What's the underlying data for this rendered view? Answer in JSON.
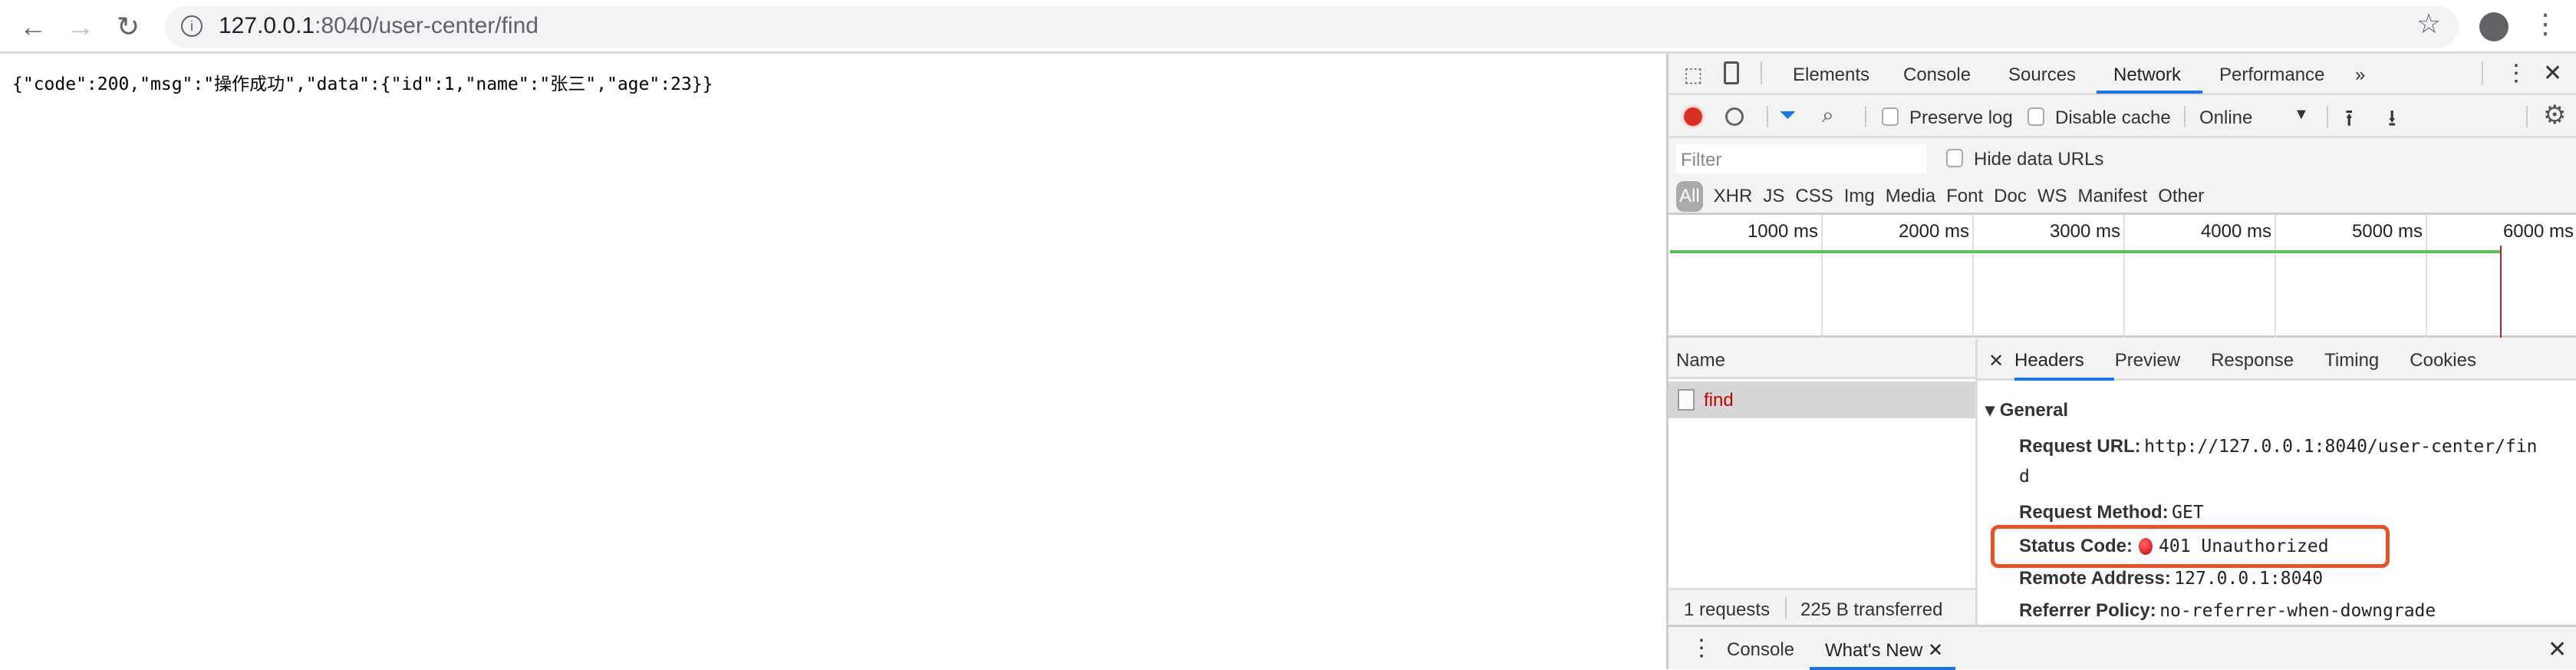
{
  "browser": {
    "url_host": "127.0.0.1",
    "url_rest": ":8040/user-center/find"
  },
  "page": {
    "body_text": "{\"code\":200,\"msg\":\"操作成功\",\"data\":{\"id\":1,\"name\":\"张三\",\"age\":23}}"
  },
  "devtools": {
    "tabs": [
      "Elements",
      "Console",
      "Sources",
      "Network",
      "Performance"
    ],
    "active_tab": "Network",
    "toolbar": {
      "preserve_log": "Preserve log",
      "disable_cache": "Disable cache",
      "throttle": "Online"
    },
    "filter": {
      "placeholder": "Filter",
      "hide_data_urls": "Hide data URLs"
    },
    "types": [
      "All",
      "XHR",
      "JS",
      "CSS",
      "Img",
      "Media",
      "Font",
      "Doc",
      "WS",
      "Manifest",
      "Other"
    ],
    "timeline": [
      "1000 ms",
      "2000 ms",
      "3000 ms",
      "4000 ms",
      "5000 ms",
      "6000 ms"
    ],
    "name_header": "Name",
    "requests": [
      {
        "name": "find",
        "color": "#c80000"
      }
    ],
    "summary": {
      "requests": "1 requests",
      "transferred": "225 B transferred"
    },
    "detail_tabs": [
      "Headers",
      "Preview",
      "Response",
      "Timing",
      "Cookies"
    ],
    "general": {
      "title": "General",
      "request_url_label": "Request URL:",
      "request_url_1": "http://127.0.0.1:8040/user-center/fin",
      "request_url_2": "d",
      "method_label": "Request Method:",
      "method": "GET",
      "status_label": "Status Code:",
      "status": "401 Unauthorized",
      "remote_label": "Remote Address:",
      "remote": "127.0.0.1:8040",
      "referrer_label": "Referrer Policy:",
      "referrer": "no-referrer-when-downgrade"
    },
    "drawer": {
      "console": "Console",
      "whats_new": "What's New"
    },
    "colors": {
      "accent": "#1a73e8",
      "highlight_box": "#e8502a",
      "record": "#d93025",
      "bar": "#5ac05a"
    }
  }
}
